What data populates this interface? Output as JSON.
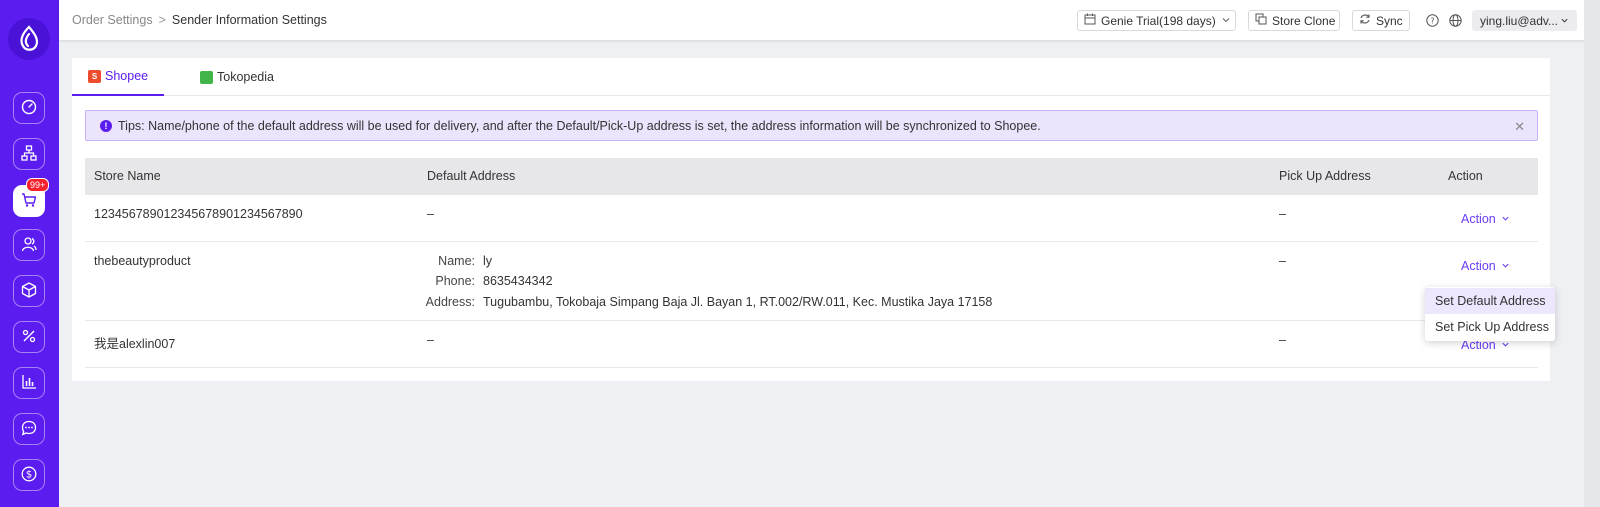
{
  "header": {
    "breadcrumb": [
      "Order Settings",
      "Sender Information Settings"
    ],
    "breadcrumb_separator": ">",
    "plan_label": "Genie Trial(198 days)",
    "store_clone_label": "Store Clone",
    "sync_label": "Sync",
    "user_label": "ying.liu@adv..."
  },
  "sidebar": {
    "cart_badge": "99+",
    "icons": [
      "dashboard-icon",
      "hierarchy-icon",
      "cart-icon",
      "users-icon",
      "box-icon",
      "percent-icon",
      "chart-icon",
      "chat-icon",
      "dollar-icon"
    ]
  },
  "tabs": [
    {
      "label": "Shopee",
      "active": true,
      "color": "#ee4d2d"
    },
    {
      "label": "Tokopedia",
      "active": false,
      "color": "#42b549"
    }
  ],
  "tips": {
    "text": "Tips: Name/phone of the default address will be used for delivery, and after the Default/Pick-Up address is set, the address information will be synchronized to Shopee."
  },
  "table": {
    "headers": [
      "Store Name",
      "Default Address",
      "Pick Up Address",
      "Action"
    ],
    "rows": [
      {
        "store": "1234567890123456789012345678​90",
        "default_address": "–",
        "pickup": "–",
        "action": "Action"
      },
      {
        "store": "thebeautyproduct",
        "name_label": "Name:",
        "name": "ly",
        "phone_label": "Phone:",
        "phone": "8635434342",
        "address_label": "Address:",
        "address": "Tugubambu, Tokobaja Simpang Baja Jl. Bayan 1, RT.002/RW.011, Kec. Mustika Jaya 17158",
        "pickup": "–",
        "action": "Action"
      },
      {
        "store": "我是alexlin007",
        "default_address": "–",
        "pickup": "–",
        "action": "Action"
      }
    ]
  },
  "dropdown": {
    "items": [
      "Set Default Address",
      "Set Pick Up Address"
    ]
  },
  "colors": {
    "accent": "#5b1cf0",
    "tips_bg": "#ece3fd",
    "badge": "#f5222d"
  }
}
